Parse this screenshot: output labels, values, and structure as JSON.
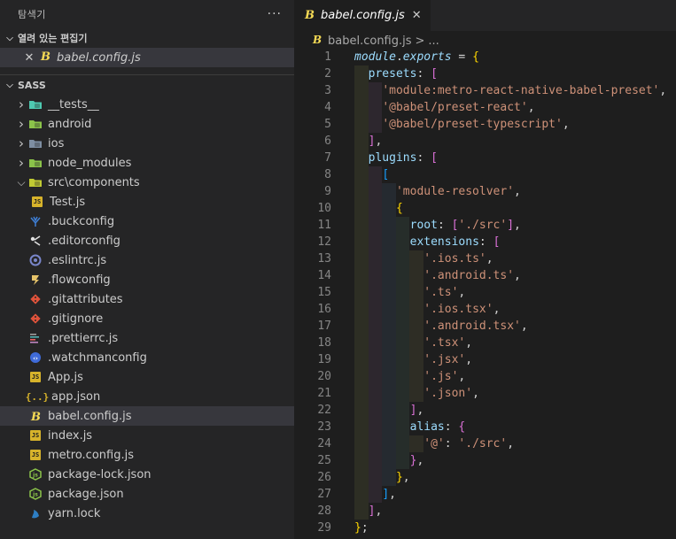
{
  "explorer": {
    "title": "탐색기",
    "more": "···",
    "open_editors_label": "열려 있는 편집기",
    "open_editor_file": "babel.config.js",
    "workspace_label": "SASS"
  },
  "tree": [
    {
      "label": "__tests__",
      "kind": "folder",
      "icon": "tests-folder-icon",
      "color": "#4ec9b0"
    },
    {
      "label": "android",
      "kind": "folder",
      "icon": "android-folder-icon",
      "color": "#8bc34a"
    },
    {
      "label": "ios",
      "kind": "folder",
      "icon": "ios-folder-icon",
      "color": "#7e8ea2"
    },
    {
      "label": "node_modules",
      "kind": "folder",
      "icon": "node-folder-icon",
      "color": "#8bc34a"
    },
    {
      "label": "src\\components",
      "kind": "folder-open",
      "icon": "components-folder-icon",
      "color": "#c0ca33"
    },
    {
      "label": "Test.js",
      "kind": "file-child",
      "icon": "js-file-icon"
    },
    {
      "label": ".buckconfig",
      "kind": "file",
      "icon": "buck-icon",
      "color": "#3f7fd6"
    },
    {
      "label": ".editorconfig",
      "kind": "file",
      "icon": "editorconfig-icon",
      "color": "#e0e0e0"
    },
    {
      "label": ".eslintrc.js",
      "kind": "file",
      "icon": "eslint-icon",
      "color": "#7986cb"
    },
    {
      "label": ".flowconfig",
      "kind": "file",
      "icon": "flow-icon",
      "color": "#e6c36a"
    },
    {
      "label": ".gitattributes",
      "kind": "file",
      "icon": "git-icon",
      "color": "#e0533b"
    },
    {
      "label": ".gitignore",
      "kind": "file",
      "icon": "git-icon",
      "color": "#e0533b"
    },
    {
      "label": ".prettierrc.js",
      "kind": "file",
      "icon": "prettier-icon",
      "color": "#9e9e9e"
    },
    {
      "label": ".watchmanconfig",
      "kind": "file",
      "icon": "watchman-icon",
      "color": "#3f6bd9"
    },
    {
      "label": "App.js",
      "kind": "file",
      "icon": "js-file-icon"
    },
    {
      "label": "app.json",
      "kind": "file",
      "icon": "json-file-icon"
    },
    {
      "label": "babel.config.js",
      "kind": "file",
      "icon": "babel-icon",
      "selected": true
    },
    {
      "label": "index.js",
      "kind": "file",
      "icon": "js-file-icon"
    },
    {
      "label": "metro.config.js",
      "kind": "file",
      "icon": "js-file-icon"
    },
    {
      "label": "package-lock.json",
      "kind": "file",
      "icon": "npm-json-icon",
      "color": "#8bc34a"
    },
    {
      "label": "package.json",
      "kind": "file",
      "icon": "npm-json-icon",
      "color": "#8bc34a"
    },
    {
      "label": "yarn.lock",
      "kind": "file",
      "icon": "yarn-icon",
      "color": "#2e7ec3"
    }
  ],
  "editor": {
    "tab_label": "babel.config.js",
    "breadcrumb_file": "babel.config.js",
    "breadcrumb_sep": ">",
    "breadcrumb_more": "...",
    "lines": [
      [
        {
          "t": "module",
          "c": "tok-mod"
        },
        {
          "t": ".",
          "c": "tok-punc"
        },
        {
          "t": "exports",
          "c": "tok-mod"
        },
        {
          "t": " = ",
          "c": "tok-punc"
        },
        {
          "t": "{",
          "c": "tok-b1"
        }
      ],
      [
        {
          "t": "  "
        },
        {
          "t": "presets",
          "c": "tok-prop"
        },
        {
          "t": ": ",
          "c": "tok-punc"
        },
        {
          "t": "[",
          "c": "tok-b2"
        }
      ],
      [
        {
          "t": "    "
        },
        {
          "t": "'module:metro-react-native-babel-preset'",
          "c": "tok-str"
        },
        {
          "t": ",",
          "c": "tok-punc"
        }
      ],
      [
        {
          "t": "    "
        },
        {
          "t": "'@babel/preset-react'",
          "c": "tok-str"
        },
        {
          "t": ",",
          "c": "tok-punc"
        }
      ],
      [
        {
          "t": "    "
        },
        {
          "t": "'@babel/preset-typescript'",
          "c": "tok-str"
        },
        {
          "t": ",",
          "c": "tok-punc"
        }
      ],
      [
        {
          "t": "  "
        },
        {
          "t": "]",
          "c": "tok-b2"
        },
        {
          "t": ",",
          "c": "tok-punc"
        }
      ],
      [
        {
          "t": "  "
        },
        {
          "t": "plugins",
          "c": "tok-prop"
        },
        {
          "t": ": ",
          "c": "tok-punc"
        },
        {
          "t": "[",
          "c": "tok-b2"
        }
      ],
      [
        {
          "t": "    "
        },
        {
          "t": "[",
          "c": "tok-b3"
        }
      ],
      [
        {
          "t": "      "
        },
        {
          "t": "'module-resolver'",
          "c": "tok-str"
        },
        {
          "t": ",",
          "c": "tok-punc"
        }
      ],
      [
        {
          "t": "      "
        },
        {
          "t": "{",
          "c": "tok-b1"
        }
      ],
      [
        {
          "t": "        "
        },
        {
          "t": "root",
          "c": "tok-prop"
        },
        {
          "t": ": ",
          "c": "tok-punc"
        },
        {
          "t": "[",
          "c": "tok-b2"
        },
        {
          "t": "'./src'",
          "c": "tok-str"
        },
        {
          "t": "]",
          "c": "tok-b2"
        },
        {
          "t": ",",
          "c": "tok-punc"
        }
      ],
      [
        {
          "t": "        "
        },
        {
          "t": "extensions",
          "c": "tok-prop"
        },
        {
          "t": ": ",
          "c": "tok-punc"
        },
        {
          "t": "[",
          "c": "tok-b2"
        }
      ],
      [
        {
          "t": "          "
        },
        {
          "t": "'.ios.ts'",
          "c": "tok-str"
        },
        {
          "t": ",",
          "c": "tok-punc"
        }
      ],
      [
        {
          "t": "          "
        },
        {
          "t": "'.android.ts'",
          "c": "tok-str"
        },
        {
          "t": ",",
          "c": "tok-punc"
        }
      ],
      [
        {
          "t": "          "
        },
        {
          "t": "'.ts'",
          "c": "tok-str"
        },
        {
          "t": ",",
          "c": "tok-punc"
        }
      ],
      [
        {
          "t": "          "
        },
        {
          "t": "'.ios.tsx'",
          "c": "tok-str"
        },
        {
          "t": ",",
          "c": "tok-punc"
        }
      ],
      [
        {
          "t": "          "
        },
        {
          "t": "'.android.tsx'",
          "c": "tok-str"
        },
        {
          "t": ",",
          "c": "tok-punc"
        }
      ],
      [
        {
          "t": "          "
        },
        {
          "t": "'.tsx'",
          "c": "tok-str"
        },
        {
          "t": ",",
          "c": "tok-punc"
        }
      ],
      [
        {
          "t": "          "
        },
        {
          "t": "'.jsx'",
          "c": "tok-str"
        },
        {
          "t": ",",
          "c": "tok-punc"
        }
      ],
      [
        {
          "t": "          "
        },
        {
          "t": "'.js'",
          "c": "tok-str"
        },
        {
          "t": ",",
          "c": "tok-punc"
        }
      ],
      [
        {
          "t": "          "
        },
        {
          "t": "'.json'",
          "c": "tok-str"
        },
        {
          "t": ",",
          "c": "tok-punc"
        }
      ],
      [
        {
          "t": "        "
        },
        {
          "t": "]",
          "c": "tok-b2"
        },
        {
          "t": ",",
          "c": "tok-punc"
        }
      ],
      [
        {
          "t": "        "
        },
        {
          "t": "alias",
          "c": "tok-prop"
        },
        {
          "t": ": ",
          "c": "tok-punc"
        },
        {
          "t": "{",
          "c": "tok-b2"
        }
      ],
      [
        {
          "t": "          "
        },
        {
          "t": "'@'",
          "c": "tok-str"
        },
        {
          "t": ": ",
          "c": "tok-punc"
        },
        {
          "t": "'./src'",
          "c": "tok-str"
        },
        {
          "t": ",",
          "c": "tok-punc"
        }
      ],
      [
        {
          "t": "        "
        },
        {
          "t": "}",
          "c": "tok-b2"
        },
        {
          "t": ",",
          "c": "tok-punc"
        }
      ],
      [
        {
          "t": "      "
        },
        {
          "t": "}",
          "c": "tok-b1"
        },
        {
          "t": ",",
          "c": "tok-punc"
        }
      ],
      [
        {
          "t": "    "
        },
        {
          "t": "]",
          "c": "tok-b3"
        },
        {
          "t": ",",
          "c": "tok-punc"
        }
      ],
      [
        {
          "t": "  "
        },
        {
          "t": "]",
          "c": "tok-b2"
        },
        {
          "t": ",",
          "c": "tok-punc"
        }
      ],
      [
        {
          "t": "}",
          "c": "tok-b1"
        },
        {
          "t": ";",
          "c": "tok-punc"
        }
      ]
    ]
  },
  "colors": {
    "sidebar_bg": "#252526",
    "editor_bg": "#1e1e1e",
    "selection_bg": "#37373d",
    "string": "#ce9178",
    "property": "#9cdcfe",
    "js_badge": "#d7b32b",
    "babel_icon": "#f5da55"
  }
}
